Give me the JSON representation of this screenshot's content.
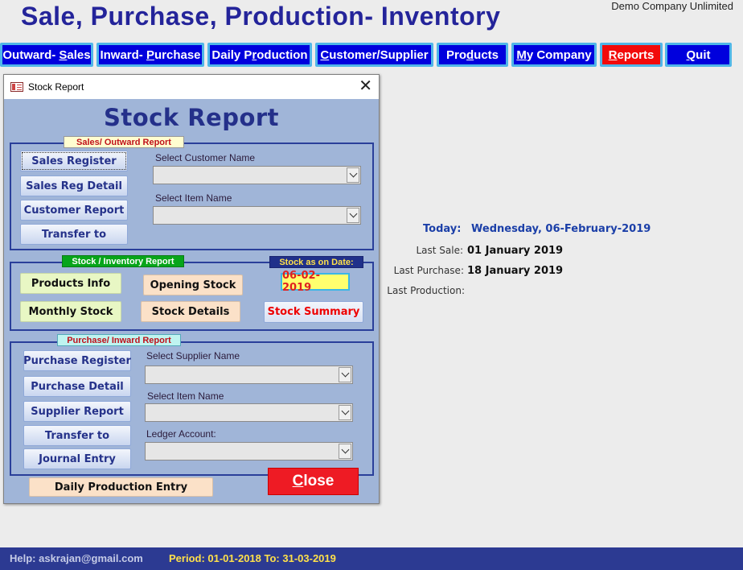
{
  "app": {
    "title": "Sale, Purchase, Production- Inventory",
    "company": "Demo Company Unlimited"
  },
  "nav": [
    {
      "label_pre": "Outward- ",
      "label_ul": "S",
      "label_post": "ales"
    },
    {
      "label_pre": "Inward- ",
      "label_ul": "P",
      "label_post": "urchase"
    },
    {
      "label_pre": "Daily P",
      "label_ul": "r",
      "label_post": "oduction"
    },
    {
      "label_pre": "",
      "label_ul": "C",
      "label_post": "ustomer/Supplier"
    },
    {
      "label_pre": "Pro",
      "label_ul": "d",
      "label_post": "ucts"
    },
    {
      "label_pre": "",
      "label_ul": "M",
      "label_post": "y Company"
    },
    {
      "label_pre": "",
      "label_ul": "R",
      "label_post": "eports"
    },
    {
      "label_pre": "",
      "label_ul": "Q",
      "label_post": "uit"
    }
  ],
  "dialog": {
    "window_title": "Stock Report",
    "heading": "Stock Report",
    "sales": {
      "section_label": "Sales/ Outward Report",
      "buttons": [
        "Sales Register",
        "Sales Reg Detail",
        "Customer Report",
        "Transfer to"
      ],
      "customer_label": "Select Customer Name",
      "item_label": "Select Item Name",
      "customer_value": "",
      "item_value": ""
    },
    "stock": {
      "section_label": "Stock / Inventory Report",
      "date_label": "Stock as on Date:",
      "date_value": "06-02-2019",
      "buttons": {
        "products_info": "Products Info",
        "opening_stock": "Opening Stock",
        "monthly_stock": "Monthly Stock",
        "stock_details": "Stock Details",
        "stock_summary": "Stock Summary"
      }
    },
    "purchase": {
      "section_label": "Purchase/ Inward Report",
      "buttons": [
        "Purchase Register",
        "Purchase Detail",
        "Supplier Report",
        "Transfer to",
        "Journal Entry"
      ],
      "supplier_label": "Select Supplier Name",
      "item_label": "Select Item Name",
      "ledger_label": "Ledger Account:",
      "supplier_value": "",
      "item_value": "",
      "ledger_value": ""
    },
    "daily_production_entry": "Daily Production Entry",
    "close_ul": "C",
    "close_rest": "lose"
  },
  "info": {
    "today_label": "Today:",
    "today_value": "Wednesday, 06-February-2019",
    "last_sale_label": "Last Sale:",
    "last_sale_value": "01 January 2019",
    "last_purchase_label": "Last Purchase:",
    "last_purchase_value": "18 January 2019",
    "last_production_label": "Last Production:",
    "last_production_value": ""
  },
  "status": {
    "help": "Help: askrajan@gmail.com",
    "period": "Period: 01-01-2018 To: 31-03-2019"
  },
  "colors": {
    "nav_bg": "#0000dd",
    "nav_active": "#f20a0a",
    "dialog_bg": "#a0b5d8",
    "status_bg": "#2c3a92"
  }
}
